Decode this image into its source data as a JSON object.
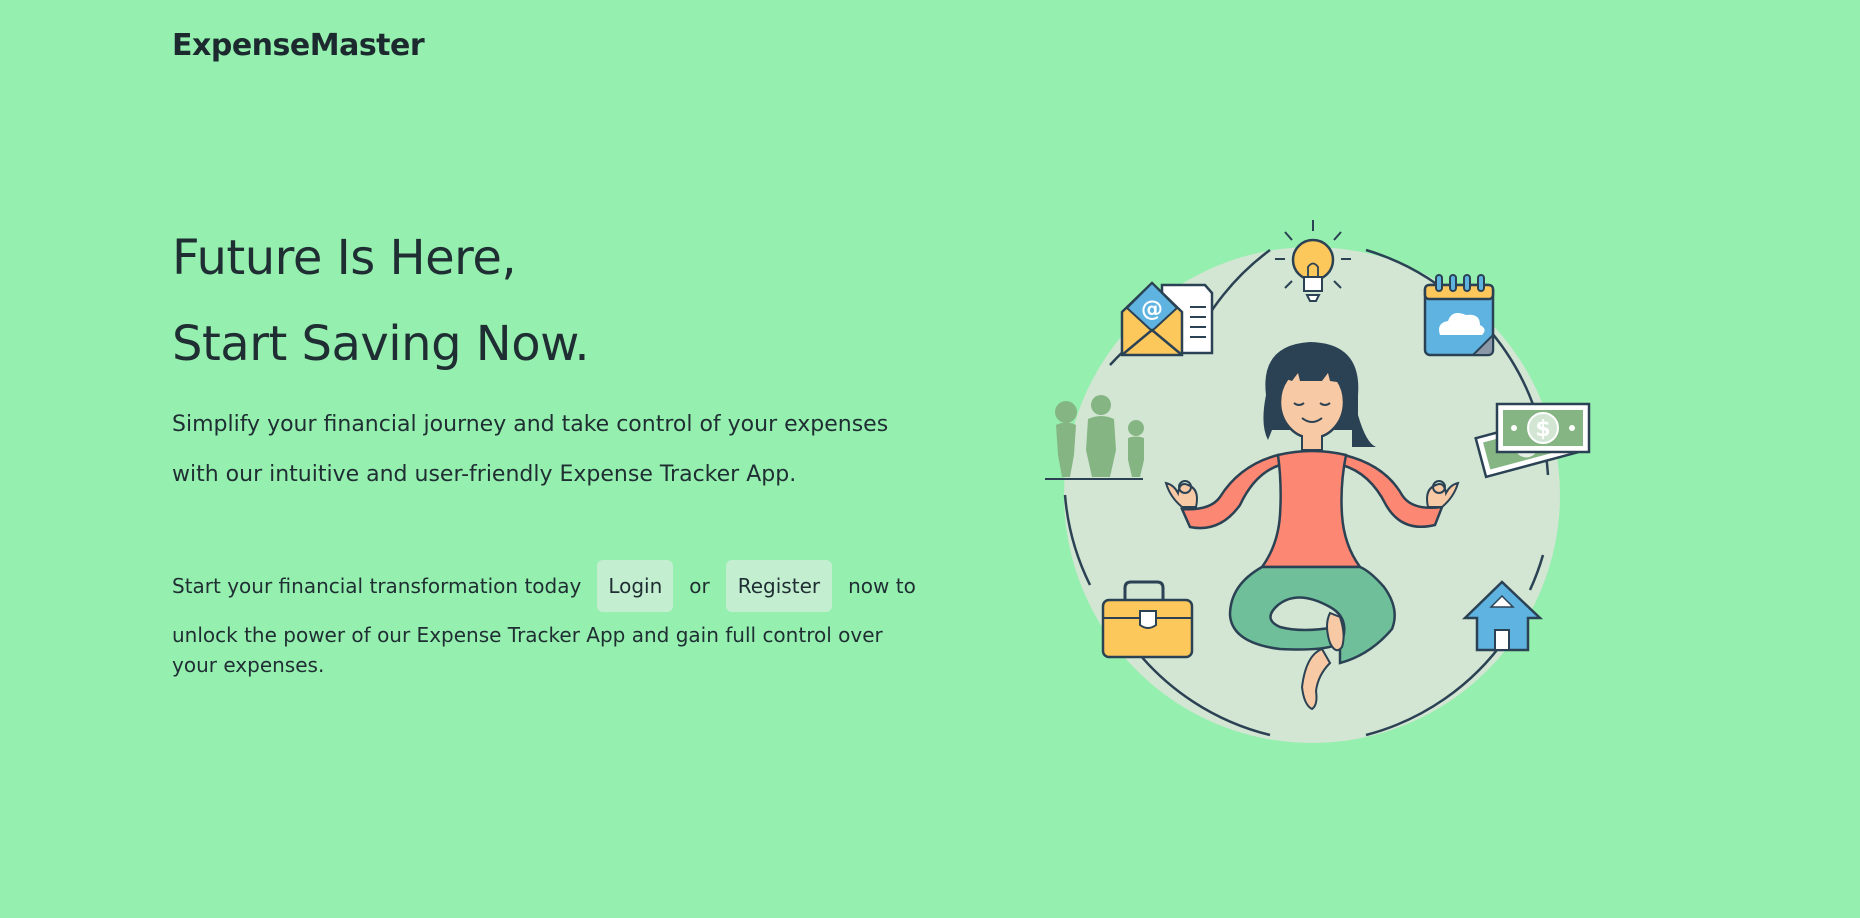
{
  "header": {
    "brand": "ExpenseMaster"
  },
  "hero": {
    "headline_line1": "Future Is Here,",
    "headline_line2": "Start Saving Now.",
    "intro_line1": "Simplify your financial journey and take control of your expenses",
    "intro_line2": "with our intuitive and user-friendly Expense Tracker App."
  },
  "cta": {
    "before": "Start your financial transformation today",
    "login_label": "Login",
    "or_text": "or",
    "register_label": "Register",
    "after": "now to",
    "rest": "unlock the power of our Expense Tracker App and gain full control over your expenses."
  },
  "illustration": {
    "icons": [
      "lightbulb-icon",
      "email-icon",
      "document-icon",
      "calendar-cloud-icon",
      "family-icon",
      "money-icon",
      "briefcase-icon",
      "house-icon"
    ]
  },
  "colors": {
    "background": "#95efae",
    "text": "#1f2e33",
    "button_bg": "#c4eed0",
    "circle": "#d2e6d3"
  }
}
